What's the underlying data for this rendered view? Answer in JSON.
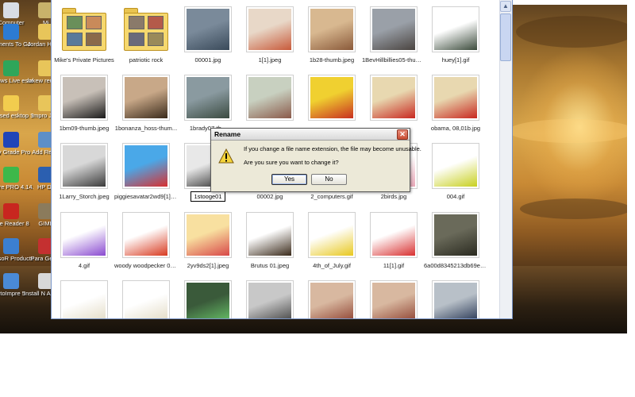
{
  "desktop": {
    "icons": [
      {
        "label": "Computer",
        "name": "desktop-icon-computer",
        "color": "#d9dde4"
      },
      {
        "label": "Mi",
        "name": "desktop-icon-mi",
        "color": "#c8b26a"
      },
      {
        "label": "cuments To Go",
        "name": "desktop-icon-documents-to-go",
        "color": "#2c7bd3"
      },
      {
        "label": "Jordan Handb",
        "name": "desktop-icon-jordan-handbook",
        "color": "#e8c55a"
      },
      {
        "label": "indows Live essenger",
        "name": "desktop-icon-windows-live-messenger",
        "color": "#2fa65a"
      },
      {
        "label": "lakew reunion",
        "name": "desktop-icon-lakewood-reunion",
        "color": "#e8c55a"
      },
      {
        "label": "Unused esktop Shortcuts",
        "name": "desktop-icon-unused-shortcuts",
        "color": "#f2cc4e"
      },
      {
        "label": "Impro Jord",
        "name": "desktop-icon-impro-jordan",
        "color": "#e8c55a"
      },
      {
        "label": "asy Grade Pro",
        "name": "desktop-icon-easy-grade-pro",
        "color": "#2045b8"
      },
      {
        "label": "Add Remo",
        "name": "desktop-icon-add-remove",
        "color": "#5d8fc7"
      },
      {
        "label": "eWire PRO 4.14.00",
        "name": "desktop-icon-limewire-pro",
        "color": "#3db84a"
      },
      {
        "label": "HP Dir",
        "name": "desktop-icon-hp-director",
        "color": "#2b5fb0"
      },
      {
        "label": "obe Reader 8",
        "name": "desktop-icon-adobe-reader",
        "color": "#c8261f"
      },
      {
        "label": "GIMP",
        "name": "desktop-icon-gimp",
        "color": "#8b7b5c"
      },
      {
        "label": "AresoR Products",
        "name": "desktop-icon-aresor-products",
        "color": "#3c7fd0"
      },
      {
        "label": "Para Gener",
        "name": "desktop-icon-para-generator",
        "color": "#c43030"
      },
      {
        "label": "otoImpre 5",
        "name": "desktop-icon-photoimpression",
        "color": "#4a8ad6"
      },
      {
        "label": "Install N Antivirus",
        "name": "desktop-icon-install-antivirus",
        "color": "#d8d8d8"
      }
    ]
  },
  "explorer": {
    "files": [
      {
        "name": "Mike's Private Pictures",
        "kind": "folder",
        "colors": [
          "#6a8f5a",
          "#c98a5a",
          "#5a7a9a",
          "#8a6a4a"
        ]
      },
      {
        "name": "patriotic rock",
        "kind": "folder",
        "colors": [
          "#8a7a6a",
          "#b45a4a",
          "#6a6a7a",
          "#9a8a5a"
        ]
      },
      {
        "name": "00001.jpg",
        "kind": "image",
        "colors": [
          "#7a8a9a",
          "#3a4a5a"
        ]
      },
      {
        "name": "1[1].jpeg",
        "kind": "image",
        "colors": [
          "#e8d8c8",
          "#c85a3a"
        ]
      },
      {
        "name": "1b28-thumb.jpeg",
        "kind": "image",
        "colors": [
          "#d8b890",
          "#8a5a3a"
        ]
      },
      {
        "name": "1BevHillbillies05-thumb...",
        "kind": "image",
        "colors": [
          "#9aa0a8",
          "#4a4440"
        ]
      },
      {
        "name": "huey[1].gif",
        "kind": "image",
        "colors": [
          "#ffffff",
          "#3a4a3a"
        ]
      },
      {
        "name": "1bm09-thumb.jpeg",
        "kind": "image",
        "colors": [
          "#c8c0b8",
          "#1a1a1a"
        ]
      },
      {
        "name": "1bonanza_hoss-thum...",
        "kind": "image",
        "colors": [
          "#c8a888",
          "#3a2a1a"
        ]
      },
      {
        "name": "1brady07-th...",
        "kind": "image",
        "colors": [
          "#8a9aa0",
          "#3a4a40"
        ]
      },
      {
        "name": "",
        "kind": "image",
        "colors": [
          "#c8d0c0",
          "#8a5a4a"
        ]
      },
      {
        "name": "",
        "kind": "image",
        "colors": [
          "#f0d030",
          "#c83020"
        ]
      },
      {
        "name": "",
        "kind": "image",
        "colors": [
          "#e8d8b0",
          "#c82820"
        ]
      },
      {
        "name": "obama, 08,01b.jpg",
        "kind": "image",
        "colors": [
          "#e8d8b0",
          "#c82820"
        ]
      },
      {
        "name": "1Larry_Storch.jpeg",
        "kind": "image",
        "colors": [
          "#d8d8d8",
          "#3a3a3a"
        ]
      },
      {
        "name": "piggiesavatar2wd9[1].gif",
        "kind": "image",
        "colors": [
          "#4aa8e8",
          "#d83030"
        ]
      },
      {
        "name": "1stooge01",
        "kind": "image",
        "colors": [
          "#e8e8e8",
          "#2a2a2a"
        ]
      },
      {
        "name": "00002.jpg",
        "kind": "image",
        "colors": [
          "#ffffff",
          "#ffffff"
        ]
      },
      {
        "name": "2_computers.gif",
        "kind": "image",
        "colors": [
          "#ffffff",
          "#ffffff"
        ]
      },
      {
        "name": "2birds.jpg",
        "kind": "image",
        "colors": [
          "#ffffff",
          "#e8a8b8"
        ]
      },
      {
        "name": "004.gif",
        "kind": "image",
        "colors": [
          "#ffffff",
          "#c8d020"
        ]
      },
      {
        "name": "4.gif",
        "kind": "image",
        "colors": [
          "#ffffff",
          "#8a4ad0"
        ]
      },
      {
        "name": "woody woodpecker 01.jpeg",
        "kind": "image",
        "colors": [
          "#ffffff",
          "#d83a20"
        ]
      },
      {
        "name": "2yv9ds2[1].jpeg",
        "kind": "image",
        "colors": [
          "#f8e0a0",
          "#d84848"
        ]
      },
      {
        "name": "Brutus 01.jpeg",
        "kind": "image",
        "colors": [
          "#ffffff",
          "#3a2a1a"
        ]
      },
      {
        "name": "4th_of_July.gif",
        "kind": "image",
        "colors": [
          "#ffffff",
          "#e8c820"
        ]
      },
      {
        "name": "11[1].gif",
        "kind": "image",
        "colors": [
          "#ffffff",
          "#d83030"
        ]
      },
      {
        "name": "6a00d8345213db69e2...",
        "kind": "image",
        "colors": [
          "#6a6a5a",
          "#2a2a20"
        ]
      },
      {
        "name": "",
        "kind": "image",
        "colors": [
          "#ffffff",
          "#e0d8c0"
        ]
      },
      {
        "name": "",
        "kind": "image",
        "colors": [
          "#ffffff",
          "#e0d8c0"
        ]
      },
      {
        "name": "",
        "kind": "image",
        "colors": [
          "#3a5a3a",
          "#6ac86a"
        ]
      },
      {
        "name": "",
        "kind": "image",
        "colors": [
          "#c8c8c8",
          "#3a3a3a"
        ]
      },
      {
        "name": "",
        "kind": "image",
        "colors": [
          "#d8b8a0",
          "#8a3a2a"
        ]
      },
      {
        "name": "",
        "kind": "image",
        "colors": [
          "#d8b8a0",
          "#8a3a2a"
        ]
      },
      {
        "name": "",
        "kind": "image",
        "colors": [
          "#b8c0c8",
          "#1a2a4a"
        ]
      }
    ]
  },
  "rename_dialog": {
    "title": "Rename",
    "close_label": "✕",
    "message_line1": "If you change a file name extension, the file may become unusable.",
    "message_line2": "Are you sure you want to change it?",
    "yes_label": "Yes",
    "no_label": "No",
    "icon": "warning-icon"
  },
  "colors": {
    "explorer_border": "#7a96c8",
    "dialog_bg": "#ece9d8"
  }
}
